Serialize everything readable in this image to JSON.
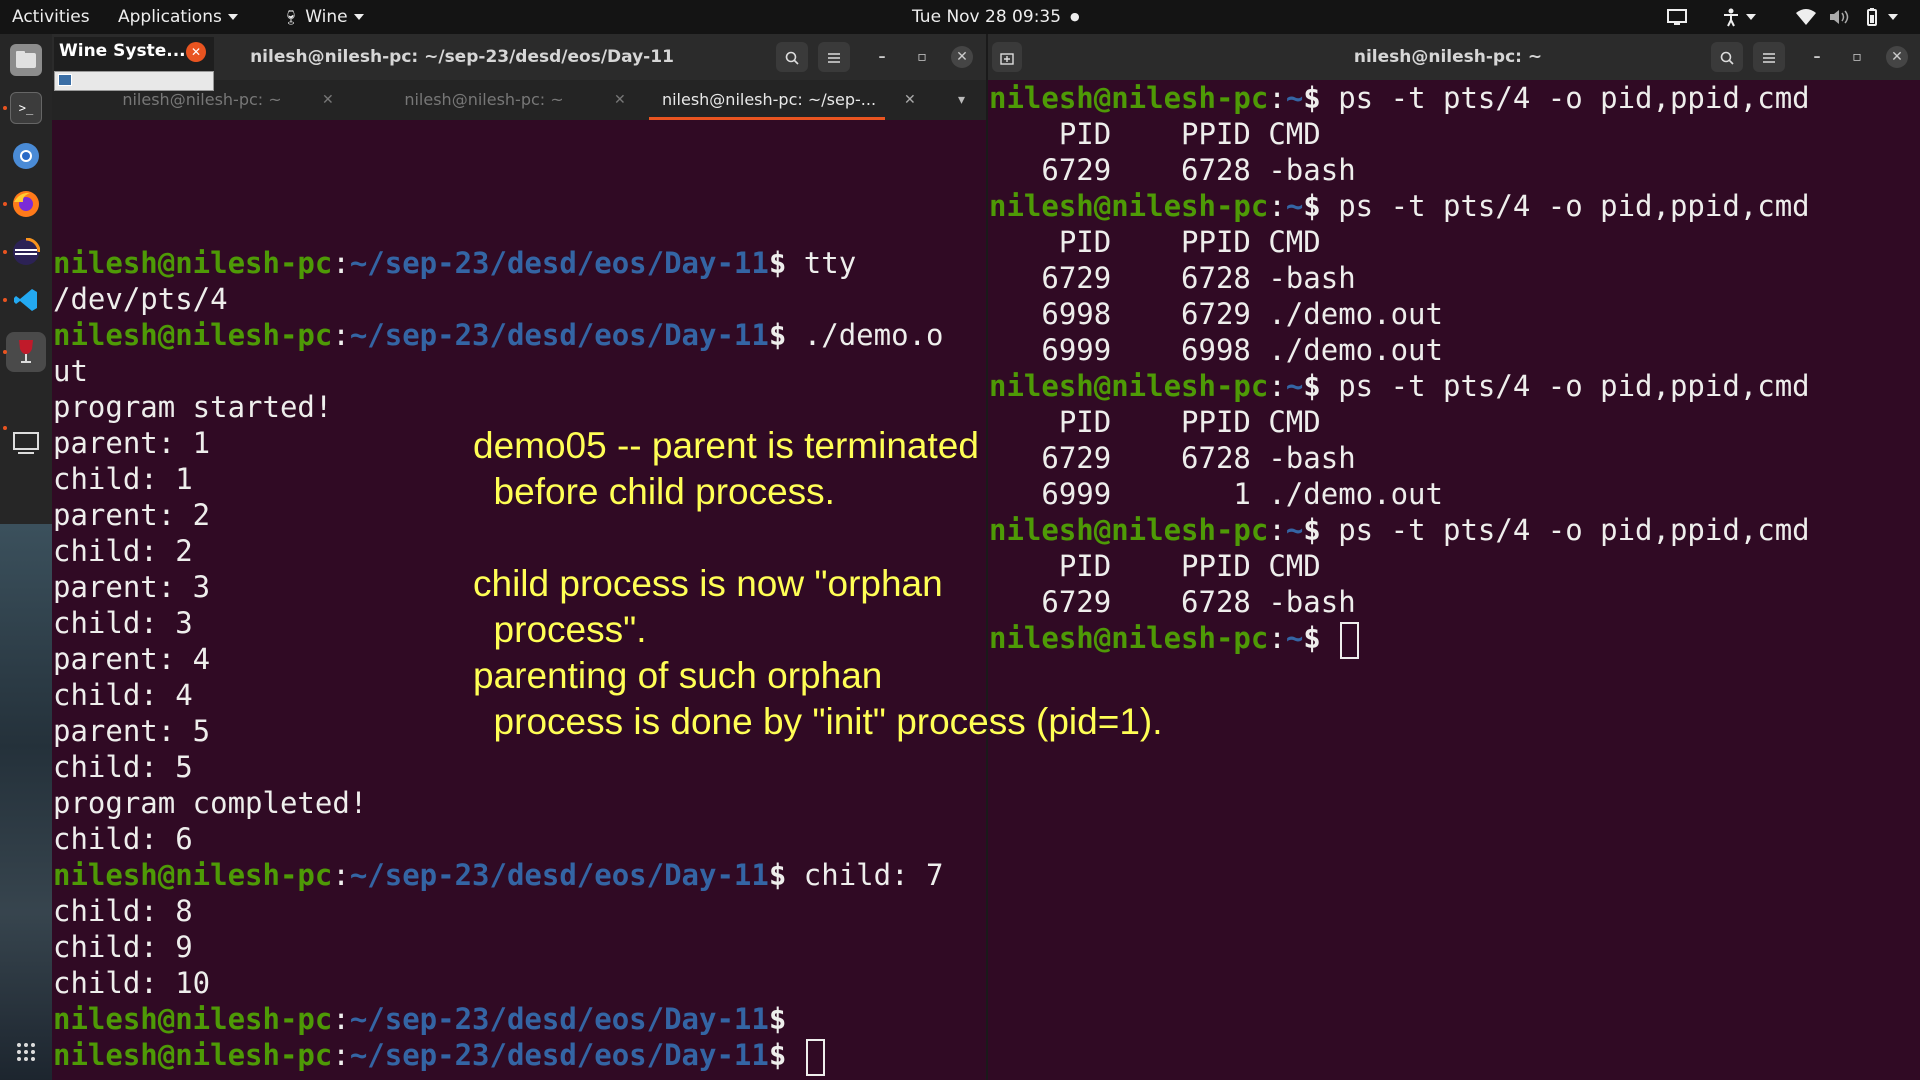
{
  "topbar": {
    "activities": "Activities",
    "applications": "Applications",
    "wine": "Wine",
    "clock": "Tue Nov 28  09:35",
    "dot": "●"
  },
  "dock": {
    "items": [
      "files-icon",
      "terminal-icon",
      "chromium-icon",
      "firefox-icon",
      "eclipse-icon",
      "vscode-icon",
      "wine-icon",
      "display-icon"
    ],
    "grid_glyph": "⋮⋮⋮"
  },
  "wine_popup": {
    "title": "Wine Syste..."
  },
  "left_window": {
    "title": "nilesh@nilesh-pc: ~/sep-23/desd/eos/Day-11",
    "tabs": [
      {
        "label": "nilesh@nilesh-pc: ~"
      },
      {
        "label": "nilesh@nilesh-pc: ~"
      },
      {
        "label": "nilesh@nilesh-pc: ~/sep-..."
      }
    ],
    "prompt_user": "nilesh@nilesh-pc",
    "prompt_path": "~/sep-23/desd/eos/Day-11",
    "prompt_sep": ":",
    "prompt_dollar": "$",
    "lines": [
      {
        "prompt": true,
        "cmd": " tty"
      },
      {
        "text": "/dev/pts/4"
      },
      {
        "prompt": true,
        "cmd": " ./demo.o"
      },
      {
        "text": "ut"
      },
      {
        "text": "program started!"
      },
      {
        "text": "parent: 1"
      },
      {
        "text": "child: 1"
      },
      {
        "text": "parent: 2"
      },
      {
        "text": "child: 2"
      },
      {
        "text": "parent: 3"
      },
      {
        "text": "child: 3"
      },
      {
        "text": "parent: 4"
      },
      {
        "text": "child: 4"
      },
      {
        "text": "parent: 5"
      },
      {
        "text": "child: 5"
      },
      {
        "text": "program completed!"
      },
      {
        "text": "child: 6"
      },
      {
        "prompt": true,
        "cmd": " child: 7"
      },
      {
        "text": "child: 8"
      },
      {
        "text": "child: 9"
      },
      {
        "text": "child: 10"
      },
      {
        "prompt": true,
        "cmd": ""
      },
      {
        "prompt": true,
        "cmd": " ",
        "cursor": true
      }
    ]
  },
  "right_window": {
    "title": "nilesh@nilesh-pc: ~",
    "prompt_user": "nilesh@nilesh-pc",
    "prompt_path": "~",
    "prompt_sep": ":",
    "prompt_dollar": "$",
    "lines": [
      {
        "prompt": true,
        "cmd": " ps -t pts/4 -o pid,ppid,cmd"
      },
      {
        "text": "    PID    PPID CMD"
      },
      {
        "text": "   6729    6728 -bash"
      },
      {
        "prompt": true,
        "cmd": " ps -t pts/4 -o pid,ppid,cmd"
      },
      {
        "text": "    PID    PPID CMD"
      },
      {
        "text": "   6729    6728 -bash"
      },
      {
        "text": "   6998    6729 ./demo.out"
      },
      {
        "text": "   6999    6998 ./demo.out"
      },
      {
        "prompt": true,
        "cmd": " ps -t pts/4 -o pid,ppid,cmd"
      },
      {
        "text": "    PID    PPID CMD"
      },
      {
        "text": "   6729    6728 -bash"
      },
      {
        "text": "   6999       1 ./demo.out"
      },
      {
        "prompt": true,
        "cmd": " ps -t pts/4 -o pid,ppid,cmd"
      },
      {
        "text": "    PID    PPID CMD"
      },
      {
        "text": "   6729    6728 -bash"
      },
      {
        "prompt": true,
        "cmd": " ",
        "cursor": true
      }
    ]
  },
  "annotation": {
    "line1": "demo05 -- parent is terminated",
    "line2": "  before child process.",
    "line3": "child process is now \"orphan",
    "line4": "  process\".",
    "line5": "parenting of such orphan",
    "line6": "  process is done by \"init\" process (pid=1)."
  },
  "colors": {
    "terminal_bg": "#300a24",
    "prompt_user": "#4e9a06",
    "prompt_path": "#3465a4",
    "annotation": "#ffff55",
    "accent": "#e95420"
  }
}
